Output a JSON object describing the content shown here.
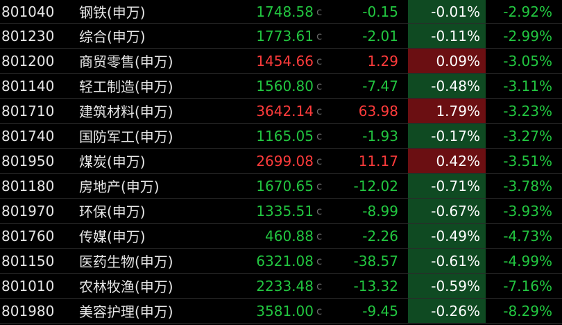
{
  "colors": {
    "up": "#ff3b3b",
    "down": "#22c640",
    "pct_up_bg": "#6b0f12",
    "pct_down_bg": "#0f4a22"
  },
  "rows": [
    {
      "code": "801040",
      "name": "钢铁(申万)",
      "price": "1748.58",
      "flag": "c",
      "change": "-0.15",
      "pct": "-0.01%",
      "pct5": "-2.92%",
      "dir": "down"
    },
    {
      "code": "801230",
      "name": "综合(申万)",
      "price": "1773.61",
      "flag": "c",
      "change": "-2.01",
      "pct": "-0.11%",
      "pct5": "-2.99%",
      "dir": "down"
    },
    {
      "code": "801200",
      "name": "商贸零售(申万)",
      "price": "1454.66",
      "flag": "c",
      "change": "1.29",
      "pct": "0.09%",
      "pct5": "-3.05%",
      "dir": "up"
    },
    {
      "code": "801140",
      "name": "轻工制造(申万)",
      "price": "1560.80",
      "flag": "c",
      "change": "-7.47",
      "pct": "-0.48%",
      "pct5": "-3.11%",
      "dir": "down"
    },
    {
      "code": "801710",
      "name": "建筑材料(申万)",
      "price": "3642.14",
      "flag": "c",
      "change": "63.98",
      "pct": "1.79%",
      "pct5": "-3.23%",
      "dir": "up"
    },
    {
      "code": "801740",
      "name": "国防军工(申万)",
      "price": "1165.05",
      "flag": "c",
      "change": "-1.93",
      "pct": "-0.17%",
      "pct5": "-3.27%",
      "dir": "down"
    },
    {
      "code": "801950",
      "name": "煤炭(申万)",
      "price": "2699.08",
      "flag": "c",
      "change": "11.17",
      "pct": "0.42%",
      "pct5": "-3.51%",
      "dir": "up"
    },
    {
      "code": "801180",
      "name": "房地产(申万)",
      "price": "1670.65",
      "flag": "c",
      "change": "-12.02",
      "pct": "-0.71%",
      "pct5": "-3.78%",
      "dir": "down"
    },
    {
      "code": "801970",
      "name": "环保(申万)",
      "price": "1335.51",
      "flag": "c",
      "change": "-8.99",
      "pct": "-0.67%",
      "pct5": "-3.93%",
      "dir": "down"
    },
    {
      "code": "801760",
      "name": "传媒(申万)",
      "price": "460.88",
      "flag": "c",
      "change": "-2.26",
      "pct": "-0.49%",
      "pct5": "-4.73%",
      "dir": "down"
    },
    {
      "code": "801150",
      "name": "医药生物(申万)",
      "price": "6321.08",
      "flag": "c",
      "change": "-38.57",
      "pct": "-0.61%",
      "pct5": "-4.99%",
      "dir": "down"
    },
    {
      "code": "801010",
      "name": "农林牧渔(申万)",
      "price": "2233.48",
      "flag": "c",
      "change": "-13.32",
      "pct": "-0.59%",
      "pct5": "-7.16%",
      "dir": "down"
    },
    {
      "code": "801980",
      "name": "美容护理(申万)",
      "price": "3581.00",
      "flag": "c",
      "change": "-9.45",
      "pct": "-0.26%",
      "pct5": "-8.29%",
      "dir": "down"
    }
  ]
}
